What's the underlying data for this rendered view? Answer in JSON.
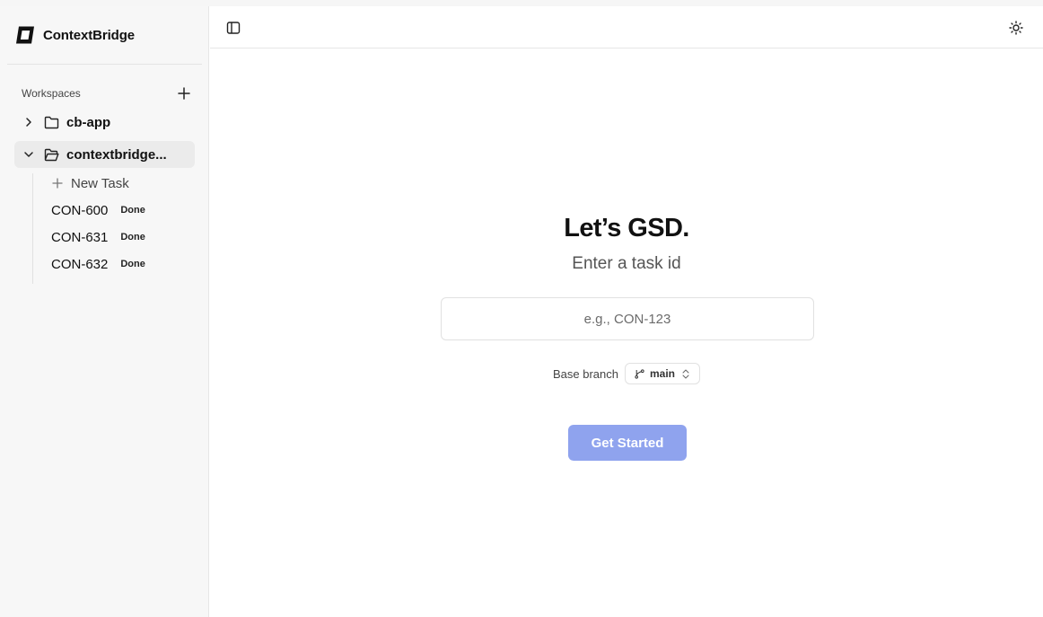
{
  "app": {
    "name": "ContextBridge"
  },
  "sidebar": {
    "workspaces_label": "Workspaces",
    "workspaces": [
      {
        "name": "cb-app",
        "expanded": false
      },
      {
        "name": "contextbridge...",
        "expanded": true
      }
    ],
    "new_task_label": "New Task",
    "tasks": [
      {
        "id": "CON-600",
        "status": "Done"
      },
      {
        "id": "CON-631",
        "status": "Done"
      },
      {
        "id": "CON-632",
        "status": "Done"
      }
    ]
  },
  "main": {
    "title": "Let’s GSD.",
    "subtitle": "Enter a task id",
    "task_input": {
      "value": "",
      "placeholder": "e.g., CON-123"
    },
    "base_branch_label": "Base branch",
    "base_branch_value": "main",
    "cta_label": "Get Started"
  },
  "colors": {
    "accent": "#8fa3ee",
    "sidebar_bg": "#f7f7f7",
    "active_item_bg": "#ebebeb",
    "border": "#e6e6e6"
  },
  "icons": {
    "header_left": "sidebar-toggle-icon",
    "header_right": "sun-icon",
    "workspace_collapsed": "chevron-right-icon",
    "workspace_expanded": "chevron-down-icon",
    "folder": "folder-icon",
    "folder_open": "folder-open-icon",
    "add": "plus-icon",
    "branch": "git-branch-icon",
    "select": "chevrons-up-down-icon"
  }
}
